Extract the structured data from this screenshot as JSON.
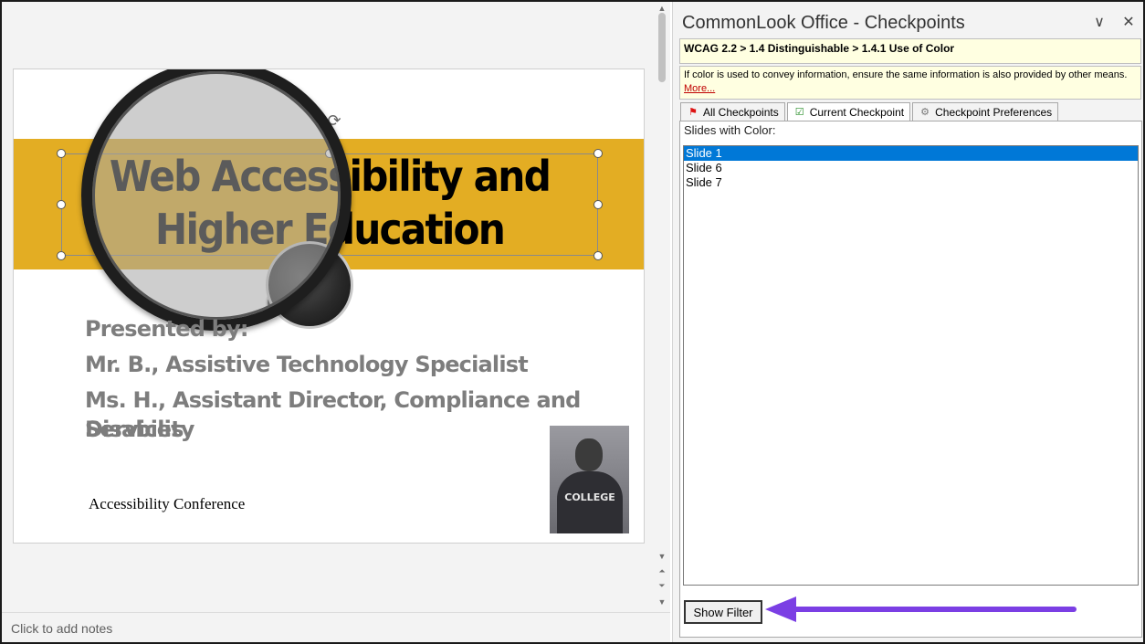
{
  "slide": {
    "title": "Web Accessibility and Higher Education",
    "presenter_lines": [
      "Presented by:",
      "Mr. B., Assistive Technology Specialist",
      "Ms. H., Assistant Director, Compliance and Disability",
      "Services"
    ],
    "footer_text": "Accessibility Conference",
    "photo_shirt_text": "COLLEGE",
    "band_color": "#e3ad23"
  },
  "notes": {
    "placeholder": "Click to add notes"
  },
  "pane": {
    "title": "CommonLook Office - Checkpoints",
    "breadcrumb": "WCAG 2.2 > 1.4 Distinguishable > 1.4.1 Use of Color",
    "description": "If color is used to convey information, ensure the same information is also provided by other means.",
    "more_link": "More...",
    "tabs": [
      {
        "label": "All Checkpoints",
        "icon": "checkpoints-flag-icon"
      },
      {
        "label": "Current Checkpoint",
        "icon": "current-checkpoint-icon"
      },
      {
        "label": "Checkpoint Preferences",
        "icon": "preferences-gear-icon"
      }
    ],
    "list_label": "Slides with Color:",
    "slides": [
      "Slide 1",
      "Slide 6",
      "Slide 7"
    ],
    "selected_index": 0,
    "show_filter_label": "Show Filter",
    "arrow_color": "#7b3fe4"
  }
}
